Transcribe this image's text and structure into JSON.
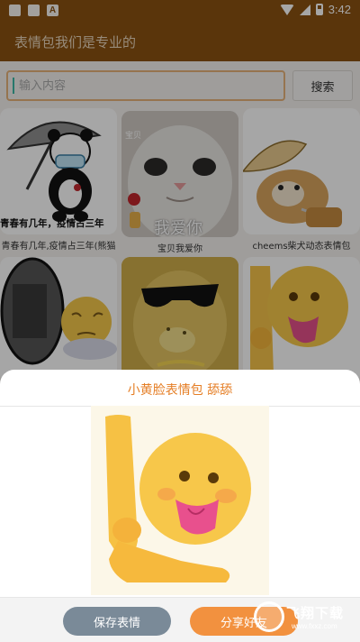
{
  "status_bar": {
    "time": "3:42",
    "icons": [
      "notification-icon",
      "notification-icon",
      "a-icon",
      "wifi-icon",
      "signal-icon",
      "battery-icon"
    ],
    "a_icon_glyph": "A"
  },
  "app_bar": {
    "title": "表情包我们是专业的"
  },
  "search": {
    "placeholder": "输入内容",
    "button_label": "搜索"
  },
  "grid": {
    "items": [
      {
        "caption": "青春有几年,疫情占三年(熊猫",
        "overlay_text": "青春有几年，疫情占三年"
      },
      {
        "caption": "宝贝我爱你",
        "overlay_text": "我爱你",
        "corner_text": "宝贝"
      },
      {
        "caption": "cheems柴犬动态表情包"
      },
      {
        "caption": ""
      },
      {
        "caption": ""
      },
      {
        "caption": ""
      }
    ]
  },
  "sheet": {
    "title": "小黄脸表情包 舔舔",
    "save_label": "保存表情",
    "share_label": "分享好友"
  },
  "watermark": {
    "big": "飞翔下载",
    "small": "www.fxxz.com"
  },
  "colors": {
    "brand": "#8a5212",
    "accent": "#e57e25",
    "share": "#f2913f",
    "save": "#7a8a98"
  }
}
